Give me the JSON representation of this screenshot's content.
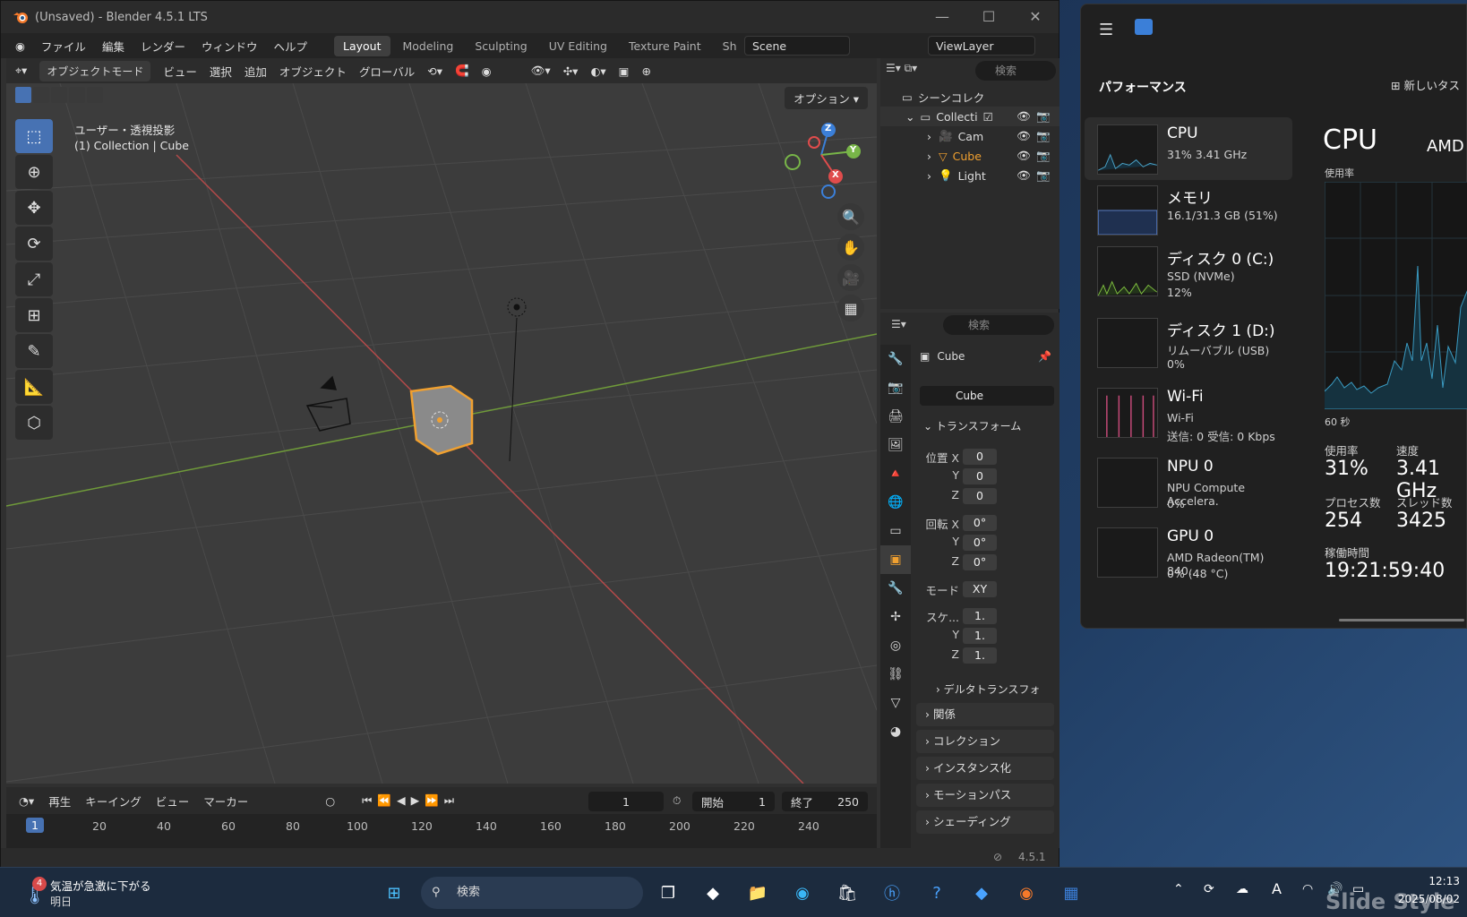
{
  "blender": {
    "title": "(Unsaved) - Blender 4.5.1 LTS",
    "menu": [
      "ファイル",
      "編集",
      "レンダー",
      "ウィンドウ",
      "ヘルプ"
    ],
    "workspaces": [
      "Layout",
      "Modeling",
      "Sculpting",
      "UV Editing",
      "Texture Paint",
      "Sh"
    ],
    "active_workspace": "Layout",
    "scene": "Scene",
    "view_layer": "ViewLayer",
    "header": {
      "mode": "オブジェクトモード",
      "view": "ビュー",
      "select": "選択",
      "add": "追加",
      "object": "オブジェクト",
      "orientation": "グローバル",
      "options": "オプション"
    },
    "viewport": {
      "line1": "ユーザー・透視投影",
      "line2": "(1) Collection | Cube"
    },
    "gizmo": {
      "x": "X",
      "y": "Y",
      "z": "Z"
    },
    "outliner": {
      "search": "検索",
      "root": "シーンコレク",
      "collection": "Collecti",
      "items": [
        "Cam",
        "Cube",
        "Light"
      ]
    },
    "properties": {
      "search": "検索",
      "object": "Cube",
      "data_name": "Cube",
      "transform": "トランスフォーム",
      "loc_label": "位置 X",
      "loc": [
        "0",
        "0",
        "0"
      ],
      "rot_label": "回転 X",
      "rot": [
        "0°",
        "0°",
        "0°"
      ],
      "mode_label": "モード",
      "mode": "XY",
      "scale_label": "スケ...",
      "scale": [
        "1.",
        "1.",
        "1."
      ],
      "axes": [
        "Y",
        "Z"
      ],
      "sections": [
        "デルタトランスフォ",
        "関係",
        "コレクション",
        "インスタンス化",
        "モーションパス",
        "シェーディング"
      ]
    },
    "timeline": {
      "play": "再生",
      "keying": "キーイング",
      "view": "ビュー",
      "marker": "マーカー",
      "current": "1",
      "start_label": "開始",
      "start": "1",
      "end_label": "終了",
      "end": "250",
      "ticks": [
        "20",
        "40",
        "60",
        "80",
        "100",
        "120",
        "140",
        "160",
        "180",
        "200",
        "220",
        "240"
      ],
      "frame_marker": "1"
    },
    "version": "4.5.1"
  },
  "taskmanager": {
    "heading": "パフォーマンス",
    "new_task": "新しいタス",
    "items": [
      {
        "name": "CPU",
        "sub1": "31% 3.41 GHz",
        "sub2": ""
      },
      {
        "name": "メモリ",
        "sub1": "16.1/31.3 GB (51%)",
        "sub2": ""
      },
      {
        "name": "ディスク 0 (C:)",
        "sub1": "SSD (NVMe)",
        "sub2": "12%"
      },
      {
        "name": "ディスク 1 (D:)",
        "sub1": "リムーバブル (USB)",
        "sub2": "0%"
      },
      {
        "name": "Wi-Fi",
        "sub1": "Wi-Fi",
        "sub2": "送信: 0 受信: 0 Kbps"
      },
      {
        "name": "NPU 0",
        "sub1": "NPU Compute Accelera.",
        "sub2": "0%"
      },
      {
        "name": "GPU 0",
        "sub1": "AMD Radeon(TM) 840...",
        "sub2": "0% (48 °C)"
      }
    ],
    "detail": {
      "title": "CPU",
      "vendor": "AMD",
      "usage_label": "使用率",
      "span": "60 秒",
      "util_label": "使用率",
      "util": "31%",
      "speed_label": "速度",
      "speed": "3.41 GHz",
      "proc_label": "プロセス数",
      "proc": "254",
      "thread_label": "スレッド数",
      "thread": "3425",
      "uptime_label": "稼働時間",
      "uptime": "19:21:59:40"
    }
  },
  "taskbar": {
    "weather": "気温が急激に下がる",
    "weather_sub": "明日",
    "badge": "4",
    "search": "検索",
    "time": "12:13",
    "date": "2025/08/02",
    "watermark": "Slide Style"
  }
}
